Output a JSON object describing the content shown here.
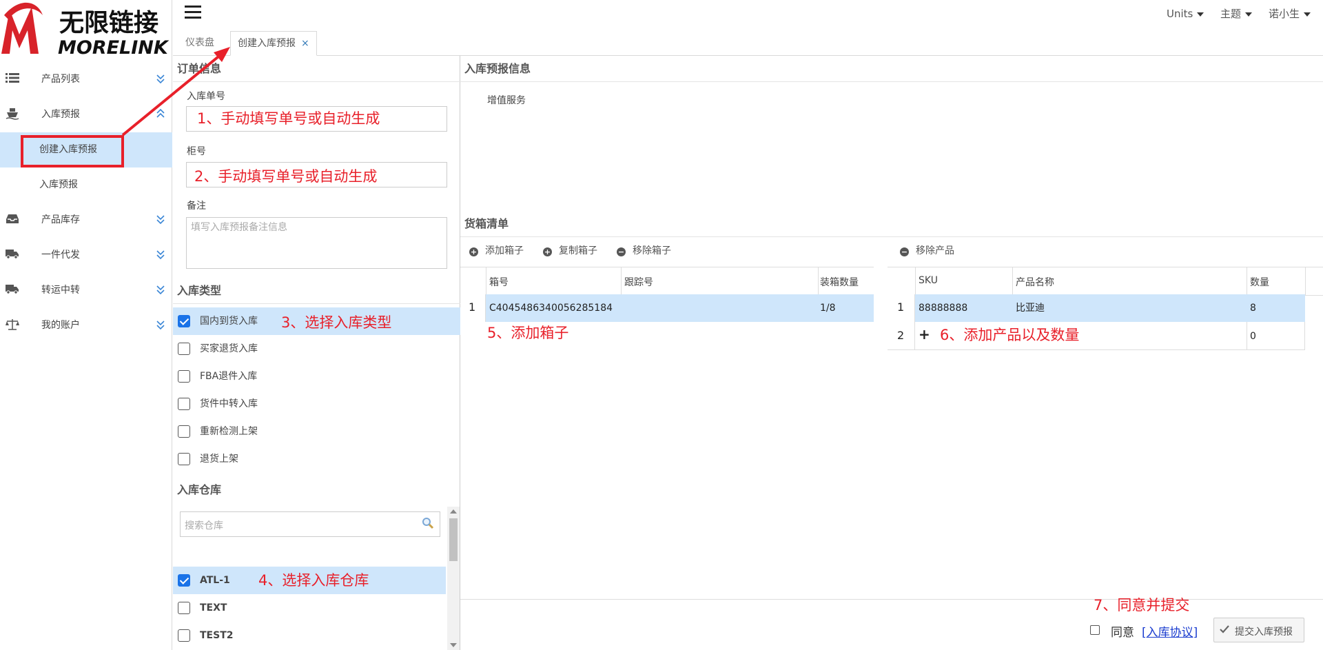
{
  "sidebar": {
    "logo": {
      "cn": "无限链接",
      "en": "MORELINK"
    },
    "items": [
      {
        "label": "产品列表",
        "icon": "list-icon"
      },
      {
        "label": "入库预报",
        "icon": "ship-icon"
      },
      {
        "label": "创建入库预报",
        "sub": true,
        "active": true
      },
      {
        "label": "入库预报",
        "sub": true
      },
      {
        "label": "产品库存",
        "icon": "inbox-icon"
      },
      {
        "label": "一件代发",
        "icon": "truck-icon"
      },
      {
        "label": "转运中转",
        "icon": "truck-icon"
      },
      {
        "label": "我的账户",
        "icon": "scale-icon"
      }
    ]
  },
  "header": {
    "menus": [
      "Units",
      "主题",
      "诺小生"
    ]
  },
  "tabs": [
    {
      "label": "仪表盘"
    },
    {
      "label": "创建入库预报",
      "close": "×"
    }
  ],
  "form": {
    "order_section": "订单信息",
    "order_no_label": "入库单号",
    "container_label": "柜号",
    "remark_label": "备注",
    "remark_placeholder": "填写入库预报备注信息",
    "type_section": "入库类型",
    "types": [
      {
        "label": "国内到货入库",
        "checked": true
      },
      {
        "label": "买家退货入库",
        "checked": false
      },
      {
        "label": "FBA退件入库",
        "checked": false
      },
      {
        "label": "货件中转入库",
        "checked": false
      },
      {
        "label": "重新检测上架",
        "checked": false
      },
      {
        "label": "退货上架",
        "checked": false
      }
    ],
    "warehouse_section": "入库仓库",
    "warehouse_search_placeholder": "搜索仓库",
    "warehouses": [
      {
        "label": "ATL-1",
        "checked": true
      },
      {
        "label": "TEXT",
        "checked": false
      },
      {
        "label": "TEST2",
        "checked": false
      }
    ]
  },
  "right": {
    "forecast_section": "入库预报信息",
    "value_added": "增值服务",
    "box_section": "货箱清单",
    "toolbar": {
      "add_box": "添加箱子",
      "copy_box": "复制箱子",
      "remove_box": "移除箱子",
      "remove_product": "移除产品"
    },
    "box_columns": [
      "箱号",
      "跟踪号",
      "装箱数量"
    ],
    "boxes": [
      {
        "idx": "1",
        "box_no": "C4045486340056285184",
        "tracking": "",
        "qty": "1/8"
      }
    ],
    "product_columns": [
      "SKU",
      "产品名称",
      "数量"
    ],
    "products": [
      {
        "idx": "1",
        "sku": "88888888",
        "name": "比亚迪",
        "qty": "8"
      },
      {
        "idx": "2",
        "sku": "+",
        "name": "",
        "qty": "0"
      }
    ],
    "agree_label": "同意",
    "agreement_link": "[入库协议]",
    "submit_label": "提交入库预报"
  },
  "annotations": [
    "1、手动填写单号或自动生成",
    "2、手动填写单号或自动生成",
    "3、选择入库类型",
    "4、选择入库仓库",
    "5、添加箱子",
    "6、添加产品以及数量",
    "7、同意并提交"
  ],
  "colors": {
    "accent": "#1a73e8",
    "selected_row": "#cfe6fb",
    "annotation": "#e8202a",
    "link": "#1a3ccf"
  }
}
